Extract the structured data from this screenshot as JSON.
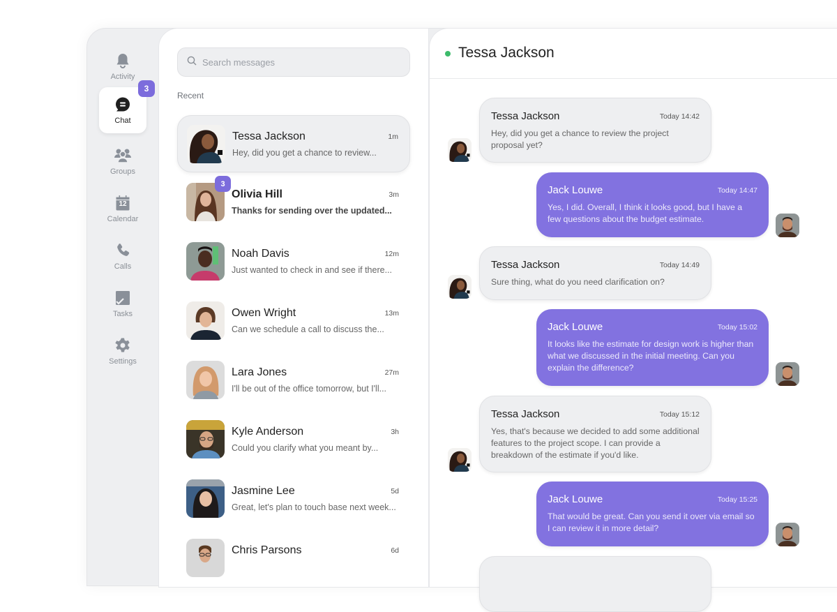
{
  "rail": {
    "items": [
      {
        "label": "Activity",
        "icon": "bell-icon"
      },
      {
        "label": "Chat",
        "icon": "chat-icon",
        "badge": "3",
        "active": true
      },
      {
        "label": "Groups",
        "icon": "groups-icon"
      },
      {
        "label": "Calendar",
        "icon": "calendar-icon",
        "day": "12"
      },
      {
        "label": "Calls",
        "icon": "phone-icon"
      },
      {
        "label": "Tasks",
        "icon": "tasks-icon"
      },
      {
        "label": "Settings",
        "icon": "gear-icon"
      }
    ]
  },
  "list": {
    "search_placeholder": "Search messages",
    "section_label": "Recent",
    "conversations": [
      {
        "name": "Tessa Jackson",
        "time": "1m",
        "preview": "Hey, did you get a chance to review...",
        "active": true
      },
      {
        "name": "Olivia Hill",
        "time": "3m",
        "preview": "Thanks for sending over the updated...",
        "unread": "3"
      },
      {
        "name": "Noah Davis",
        "time": "12m",
        "preview": "Just wanted to check in and see if there..."
      },
      {
        "name": "Owen Wright",
        "time": "13m",
        "preview": "Can we schedule a call to discuss the..."
      },
      {
        "name": "Lara Jones",
        "time": "27m",
        "preview": "I'll be out of the office tomorrow, but I'll..."
      },
      {
        "name": "Kyle Anderson",
        "time": "3h",
        "preview": "Could you clarify what you meant by..."
      },
      {
        "name": "Jasmine Lee",
        "time": "5d",
        "preview": "Great, let's plan to touch base next week..."
      },
      {
        "name": "Chris Parsons",
        "time": "6d",
        "preview": ""
      }
    ]
  },
  "chat": {
    "title": "Tessa Jackson",
    "status": "online",
    "messages": [
      {
        "sender": "Tessa Jackson",
        "time": "Today 14:42",
        "text": "Hey, did you get a chance to review the project proposal yet?",
        "direction": "in"
      },
      {
        "sender": "Jack Louwe",
        "time": "Today 14:47",
        "text": "Yes, I did. Overall, I think it looks good, but I have a few questions about the budget estimate.",
        "direction": "out"
      },
      {
        "sender": "Tessa Jackson",
        "time": "Today 14:49",
        "text": "Sure thing, what do you need clarification on?",
        "direction": "in"
      },
      {
        "sender": "Jack Louwe",
        "time": "Today 15:02",
        "text": "It looks like the estimate for design work is higher than what we discussed in the initial meeting. Can you explain the difference?",
        "direction": "out"
      },
      {
        "sender": "Tessa Jackson",
        "time": "Today 15:12",
        "text": "Yes, that's because we decided to add some additional features to the project scope. I can provide a breakdown of the estimate if you'd like.",
        "direction": "in"
      },
      {
        "sender": "Jack Louwe",
        "time": "Today 15:25",
        "text": "That would be great. Can you send it over via email so I can review it in more detail?",
        "direction": "out"
      }
    ]
  },
  "colors": {
    "accent": "#8272e0",
    "badge": "#7c6cdc",
    "online": "#3dbb6b"
  }
}
